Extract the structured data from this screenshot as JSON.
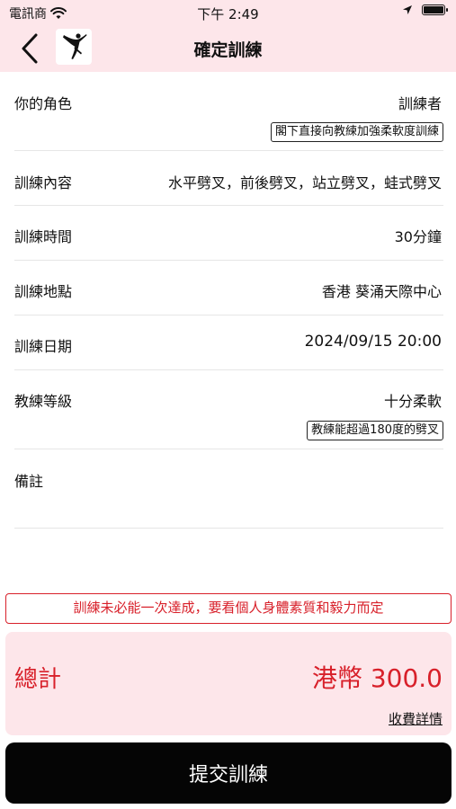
{
  "status_bar": {
    "carrier": "電訊商",
    "time": "下午 2:49"
  },
  "header": {
    "title": "確定訓練"
  },
  "details": {
    "role_label": "你的角色",
    "role_value": "訓練者",
    "role_tag": "閣下直接向教練加強柔軟度訓練",
    "content_label": "訓練內容",
    "content_value": "水平劈叉，前後劈叉，站立劈叉，蛙式劈叉",
    "duration_label": "訓練時間",
    "duration_value": "30分鐘",
    "location_label": "訓練地點",
    "location_value": "香港 葵涌天際中心",
    "date_label": "訓練日期",
    "date_value": "2024/09/15 20:00",
    "level_label": "教練等級",
    "level_value": "十分柔軟",
    "level_tag": "教練能超過180度的劈叉",
    "remarks_label": "備註",
    "remarks_value": ""
  },
  "notice": "訓練未必能一次達成，要看個人身體素質和毅力而定",
  "total": {
    "label": "總計",
    "amount": "港幣 300.0",
    "fee_details": "收費詳情"
  },
  "submit_label": "提交訓練",
  "colors": {
    "accent_red": "#d8202a",
    "header_pink": "#fde6ea",
    "button_black": "#050505"
  }
}
